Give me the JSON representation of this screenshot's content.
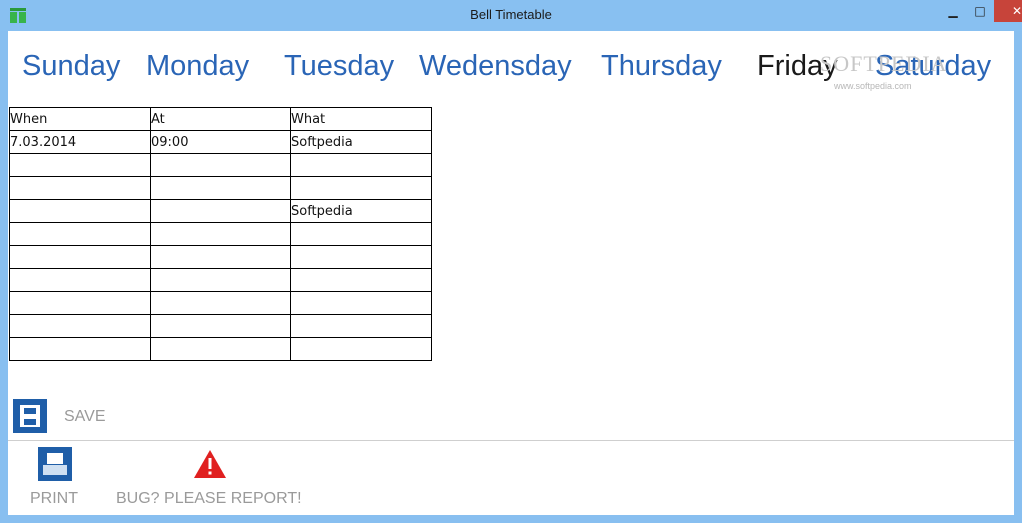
{
  "window": {
    "title": "Bell Timetable",
    "min_glyph": "▁",
    "max_glyph": "□",
    "close_glyph": "✕"
  },
  "days": [
    "Sunday",
    "Monday",
    "Tuesday",
    "Wedensday",
    "Thursday",
    "Friday",
    "Saturday"
  ],
  "selected_day": "Friday",
  "watermark": {
    "text": "SOFTPEDIA",
    "url": "www.softpedia.com"
  },
  "table": {
    "headers": [
      "When",
      "At",
      "What"
    ],
    "rows": [
      [
        "7.03.2014",
        "09:00",
        "Softpedia"
      ],
      [
        "",
        "",
        ""
      ],
      [
        "",
        "",
        ""
      ],
      [
        "",
        "",
        "Softpedia"
      ],
      [
        "",
        "",
        ""
      ],
      [
        "",
        "",
        ""
      ],
      [
        "",
        "",
        ""
      ],
      [
        "",
        "",
        ""
      ],
      [
        "",
        "",
        ""
      ],
      [
        "",
        "",
        ""
      ]
    ]
  },
  "actions": {
    "save_label": "SAVE",
    "print_label": "PRINT",
    "bug_label": "BUG? PLEASE REPORT!"
  },
  "colors": {
    "accent": "#2a65b6",
    "icon_bg": "#1f5ea8",
    "warning": "#e02020",
    "titlebar": "#88c0f1"
  }
}
